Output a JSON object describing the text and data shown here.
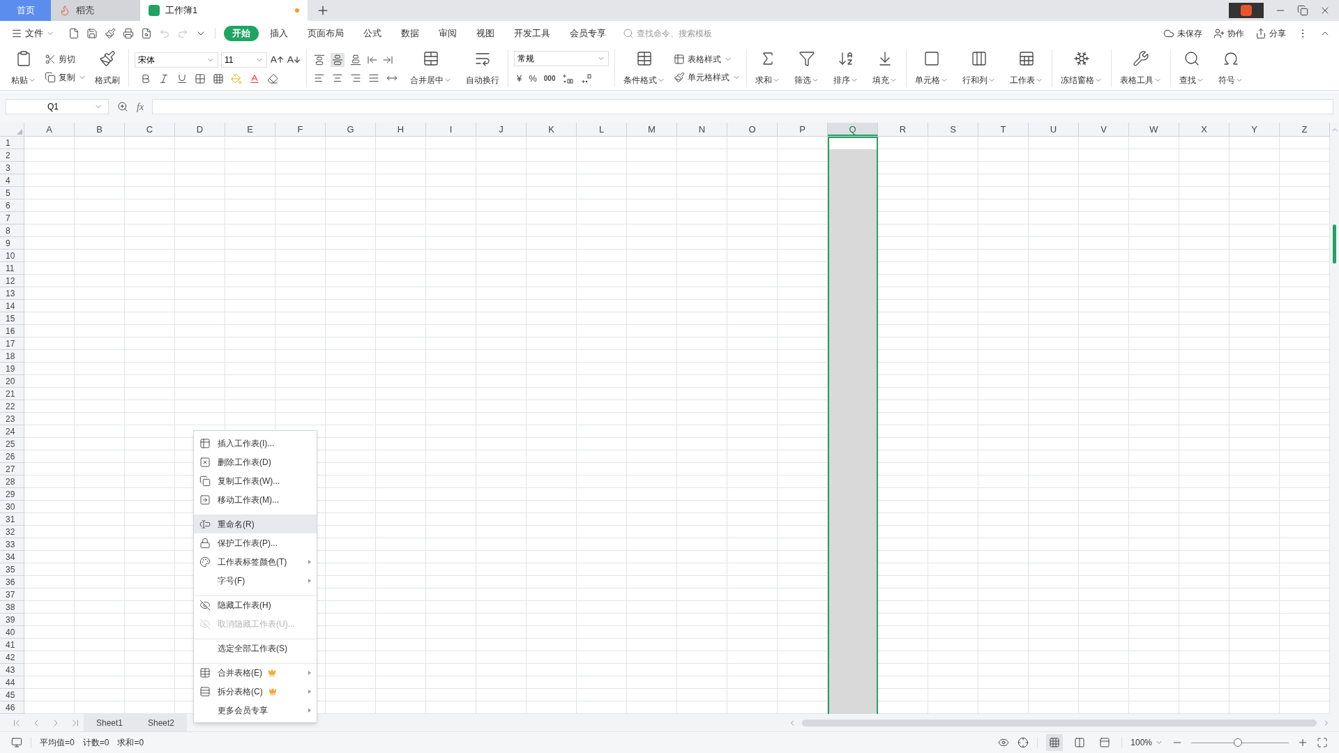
{
  "title_tabs": [
    {
      "label": "首页",
      "kind": "home",
      "selected": false
    },
    {
      "label": "稻壳",
      "kind": "docer",
      "selected": false
    },
    {
      "label": "工作簿1",
      "kind": "sheet",
      "selected": true,
      "unsaved": true
    }
  ],
  "menu": {
    "file": "文件",
    "tabs": [
      {
        "label": "开始",
        "selected": true
      },
      {
        "label": "插入",
        "selected": false
      },
      {
        "label": "页面布局",
        "selected": false
      },
      {
        "label": "公式",
        "selected": false
      },
      {
        "label": "数据",
        "selected": false
      },
      {
        "label": "审阅",
        "selected": false
      },
      {
        "label": "视图",
        "selected": false
      },
      {
        "label": "开发工具",
        "selected": false
      },
      {
        "label": "会员专享",
        "selected": false
      }
    ],
    "search": {
      "placeholder": "查找命令、搜索模板"
    },
    "actions": [
      "未保存",
      "协作",
      "分享"
    ]
  },
  "ribbon": {
    "clipboard": {
      "paste": "粘贴",
      "cut": "剪切",
      "copy": "复制",
      "format_painter": "格式刷"
    },
    "font": {
      "name": "宋体",
      "size": "11"
    },
    "vertical_align": [
      {
        "selected": false
      },
      {
        "selected": true
      },
      {
        "selected": false
      }
    ],
    "merge": "合并居中",
    "wrap": "自动换行",
    "number": {
      "format": "常规",
      "currency": "¥",
      "percent": "%",
      "thousands": "000"
    },
    "styles": {
      "conditional": "条件格式",
      "table_style": "表格样式",
      "cell_style": "单元格样式"
    },
    "tool_groups": [
      [
        "求和",
        "筛选",
        "排序",
        "填充"
      ],
      [
        "单元格",
        "行和列",
        "工作表"
      ],
      [
        "冻结窗格"
      ],
      [
        "表格工具"
      ],
      [
        "查找",
        "符号"
      ]
    ]
  },
  "formula_bar": {
    "name_box": "Q1",
    "fx": "fx"
  },
  "columns": [
    {
      "label": "A",
      "selected": false
    },
    {
      "label": "B",
      "selected": false
    },
    {
      "label": "C",
      "selected": false
    },
    {
      "label": "D",
      "selected": false
    },
    {
      "label": "E",
      "selected": false
    },
    {
      "label": "F",
      "selected": false
    },
    {
      "label": "G",
      "selected": false
    },
    {
      "label": "H",
      "selected": false
    },
    {
      "label": "I",
      "selected": false
    },
    {
      "label": "J",
      "selected": false
    },
    {
      "label": "K",
      "selected": false
    },
    {
      "label": "L",
      "selected": false
    },
    {
      "label": "M",
      "selected": false
    },
    {
      "label": "N",
      "selected": false
    },
    {
      "label": "O",
      "selected": false
    },
    {
      "label": "P",
      "selected": false
    },
    {
      "label": "Q",
      "selected": true
    },
    {
      "label": "R",
      "selected": false
    },
    {
      "label": "S",
      "selected": false
    },
    {
      "label": "T",
      "selected": false
    },
    {
      "label": "U",
      "selected": false
    },
    {
      "label": "V",
      "selected": false
    },
    {
      "label": "W",
      "selected": false
    },
    {
      "label": "X",
      "selected": false
    },
    {
      "label": "Y",
      "selected": false
    },
    {
      "label": "Z",
      "selected": false
    }
  ],
  "rows": [
    "1",
    "2",
    "3",
    "4",
    "5",
    "6",
    "7",
    "8",
    "9",
    "10",
    "11",
    "12",
    "13",
    "14",
    "15",
    "16",
    "17",
    "18",
    "19",
    "20",
    "21",
    "22",
    "23",
    "24",
    "25",
    "26",
    "27",
    "28",
    "29",
    "30",
    "31",
    "32",
    "33",
    "34",
    "35",
    "36",
    "37",
    "38",
    "39",
    "40",
    "41",
    "42",
    "43",
    "44",
    "45",
    "46"
  ],
  "context_menu": [
    {
      "label": "插入工作表(I)...",
      "selected": false,
      "disabled": false,
      "submenu": false,
      "vip": false,
      "group_start": false
    },
    {
      "label": "删除工作表(D)",
      "selected": false,
      "disabled": false,
      "submenu": false,
      "vip": false,
      "group_start": false
    },
    {
      "label": "复制工作表(W)...",
      "selected": false,
      "disabled": false,
      "submenu": false,
      "vip": false,
      "group_start": false
    },
    {
      "label": "移动工作表(M)...",
      "selected": false,
      "disabled": false,
      "submenu": false,
      "vip": false,
      "group_start": false
    },
    {
      "label": "重命名(R)",
      "selected": true,
      "disabled": false,
      "submenu": false,
      "vip": false,
      "group_start": true
    },
    {
      "label": "保护工作表(P)...",
      "selected": false,
      "disabled": false,
      "submenu": false,
      "vip": false,
      "group_start": false
    },
    {
      "label": "工作表标签颜色(T)",
      "selected": false,
      "disabled": false,
      "submenu": true,
      "vip": false,
      "group_start": false
    },
    {
      "label": "字号(F)",
      "selected": false,
      "disabled": false,
      "submenu": true,
      "vip": false,
      "group_start": false
    },
    {
      "label": "隐藏工作表(H)",
      "selected": false,
      "disabled": false,
      "submenu": false,
      "vip": false,
      "group_start": true
    },
    {
      "label": "取消隐藏工作表(U)...",
      "selected": false,
      "disabled": true,
      "submenu": false,
      "vip": false,
      "group_start": false
    },
    {
      "label": "选定全部工作表(S)",
      "selected": false,
      "disabled": false,
      "submenu": false,
      "vip": false,
      "group_start": true
    },
    {
      "label": "合并表格(E)",
      "selected": false,
      "disabled": false,
      "submenu": true,
      "vip": true,
      "group_start": true
    },
    {
      "label": "拆分表格(C)",
      "selected": false,
      "disabled": false,
      "submenu": true,
      "vip": true,
      "group_start": false
    },
    {
      "label": "更多会员专享",
      "selected": false,
      "disabled": false,
      "submenu": true,
      "vip": false,
      "group_start": false
    }
  ],
  "sheet_tabs": [
    {
      "label": "Sheet1",
      "selected": false
    },
    {
      "label": "Sheet2",
      "selected": false
    }
  ],
  "status_bar": {
    "stats": [
      "平均值=0",
      "计数=0",
      "求和=0"
    ],
    "views": [
      {
        "selected": true
      },
      {
        "selected": false
      },
      {
        "selected": false
      }
    ],
    "zoom": "100%",
    "zoom_slider": {
      "level": 0.48
    }
  }
}
